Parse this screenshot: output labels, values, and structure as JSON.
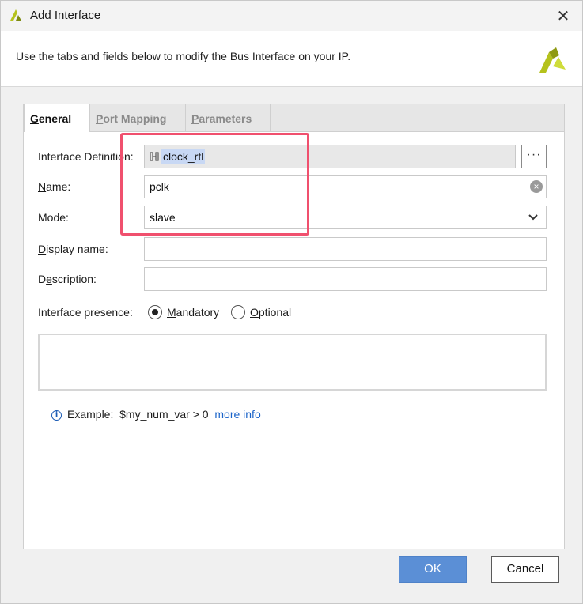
{
  "window": {
    "title": "Add Interface",
    "close_label": "✕"
  },
  "banner": {
    "text": "Use the tabs and fields below to modify the Bus Interface on your IP."
  },
  "tabs": [
    {
      "label_first": "G",
      "label_rest": "eneral",
      "active": true
    },
    {
      "label_first": "P",
      "label_rest": "ort Mapping",
      "active": false
    },
    {
      "label_first": "P",
      "label_rest": "arameters",
      "active": false
    }
  ],
  "form": {
    "interface_definition": {
      "label": "Interface Definition:",
      "value": "clock_rtl",
      "browse_label": "···"
    },
    "name": {
      "label_first": "N",
      "label_rest": "ame:",
      "value": "pclk"
    },
    "mode": {
      "label": "Mode:",
      "value": "slave"
    },
    "display_name": {
      "label_first": "D",
      "label_rest": "isplay name:",
      "value": ""
    },
    "description": {
      "label_pre": "D",
      "label_u": "e",
      "label_rest": "scription:",
      "value": ""
    },
    "presence": {
      "label": "Interface presence:",
      "options": [
        {
          "first": "M",
          "rest": "andatory",
          "checked": true
        },
        {
          "first": "O",
          "rest": "ptional",
          "checked": false
        }
      ]
    }
  },
  "hint": {
    "prefix": "Example:",
    "example": "$my_num_var > 0",
    "link": "more info"
  },
  "buttons": {
    "ok": "OK",
    "cancel": "Cancel"
  },
  "colors": {
    "accent": "#5b8fd6",
    "highlight_box": "#f0506e",
    "link": "#1a63c9",
    "logo": "#b5c21c"
  }
}
